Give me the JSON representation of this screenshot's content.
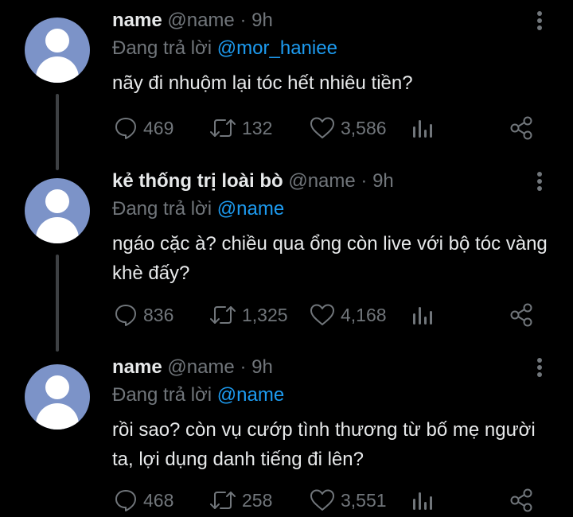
{
  "tweets": [
    {
      "display_name": "name",
      "handle": "@name",
      "time": "· 9h",
      "reply_prefix": "Đang trả lời ",
      "reply_to": "@mor_haniee",
      "text": "nãy đi nhuộm lại tóc hết nhiêu tiền?",
      "replies": "469",
      "retweets": "132",
      "likes": "3,586"
    },
    {
      "display_name": "kẻ thống trị loài bò",
      "handle": "@name",
      "time": "· 9h",
      "reply_prefix": "Đang trả lời ",
      "reply_to": "@name",
      "text": "ngáo cặc à? chiều qua ổng còn live với bộ tóc vàng khè đấy?",
      "replies": "836",
      "retweets": "1,325",
      "likes": "4,168"
    },
    {
      "display_name": "name",
      "handle": "@name",
      "time": "· 9h",
      "reply_prefix": "Đang trả lời ",
      "reply_to": "@name",
      "text": "rồi sao? còn vụ cướp tình thương từ bố mẹ người ta, lợi dụng danh tiếng đi lên?",
      "replies": "468",
      "retweets": "258",
      "likes": "3,551"
    }
  ],
  "icons": {
    "reply": "reply-icon",
    "retweet": "retweet-icon",
    "like": "heart-icon",
    "views": "views-icon",
    "share": "share-icon",
    "more": "more-icon"
  },
  "colors": {
    "background": "#000000",
    "text": "#e7e9ea",
    "muted": "#71767b",
    "link": "#1d9bf0",
    "avatar": "#7c93c8"
  }
}
